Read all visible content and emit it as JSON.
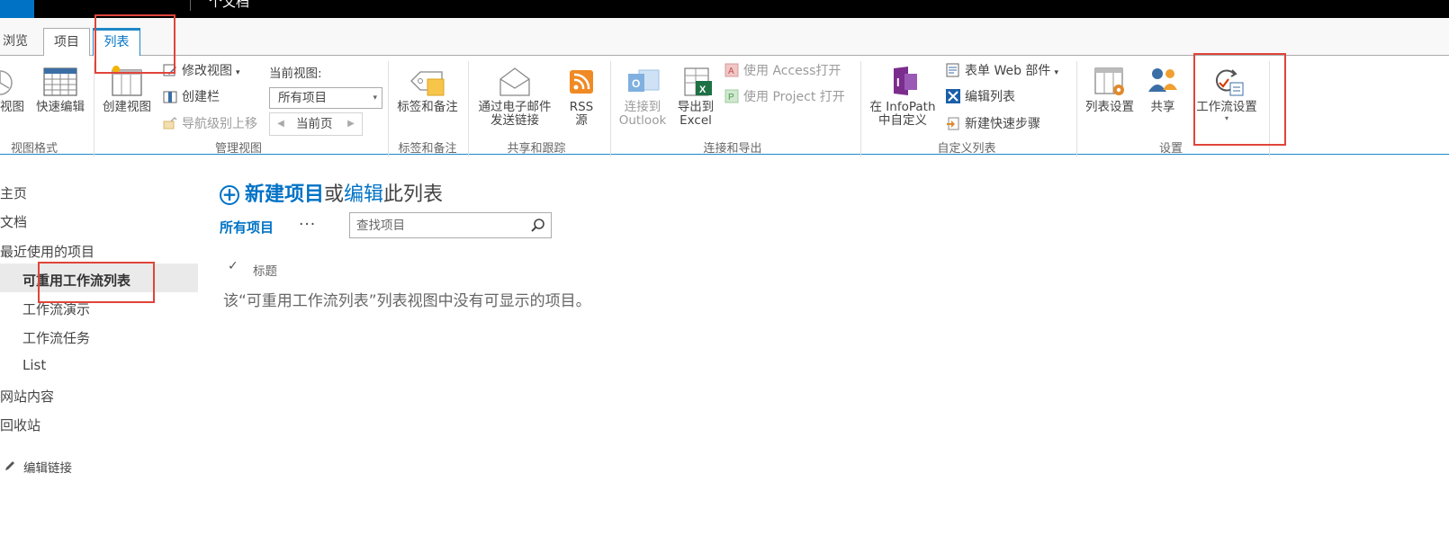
{
  "topbar": {
    "title": "个文档"
  },
  "tabs": [
    {
      "label": "浏览"
    },
    {
      "label": "项目"
    },
    {
      "label": "列表"
    }
  ],
  "ribbon": {
    "groups": {
      "view_format": "视图格式",
      "manage_views": "管理视图",
      "tags_notes": "标签和备注",
      "share_track": "共享和跟踪",
      "connect_export": "连接和导出",
      "customize_list": "自定义列表",
      "settings": "设置"
    },
    "buttons": {
      "view": "视图",
      "quick_edit": "快速编辑",
      "create_view": "创建视图",
      "modify_view": "修改视图",
      "create_column": "创建栏",
      "navigate_up": "导航级别上移",
      "current_view_label": "当前视图:",
      "current_view_value": "所有项目",
      "current_page": "当前页",
      "tags_notes": "标签和备注",
      "email_link_line1": "通过电子邮件",
      "email_link_line2": "发送链接",
      "rss_line1": "RSS",
      "rss_line2": "源",
      "outlook_line1": "连接到",
      "outlook_line2": "Outlook",
      "excel_line1": "导出到",
      "excel_line2": "Excel",
      "open_access": "使用 Access打开",
      "open_project": "使用 Project 打开",
      "infopath_line1": "在 InfoPath",
      "infopath_line2": "中自定义",
      "form_web_parts": "表单 Web 部件",
      "edit_list": "编辑列表",
      "new_quick_step": "新建快速步骤",
      "list_settings": "列表设置",
      "share": "共享",
      "workflow_settings": "工作流设置"
    }
  },
  "nav": {
    "items": [
      {
        "label": "主页"
      },
      {
        "label": "文档"
      },
      {
        "label": "最近使用的项目"
      },
      {
        "label": "可重用工作流列表"
      },
      {
        "label": "工作流演示"
      },
      {
        "label": "工作流任务"
      },
      {
        "label": "List"
      },
      {
        "label": "网站内容"
      },
      {
        "label": "回收站"
      }
    ],
    "edit_links": "编辑链接"
  },
  "main": {
    "new_item": "新建项目",
    "or": "或",
    "edit": "编辑",
    "this_list": "此列表",
    "view_all": "所有项目",
    "more": "···",
    "search_placeholder": "查找项目",
    "col_title": "标题",
    "empty_message": "该“可重用工作流列表”列表视图中没有可显示的项目。"
  },
  "colors": {
    "accent": "#0072c6",
    "highlight_box": "#e0443a",
    "topbar": "#000000"
  }
}
